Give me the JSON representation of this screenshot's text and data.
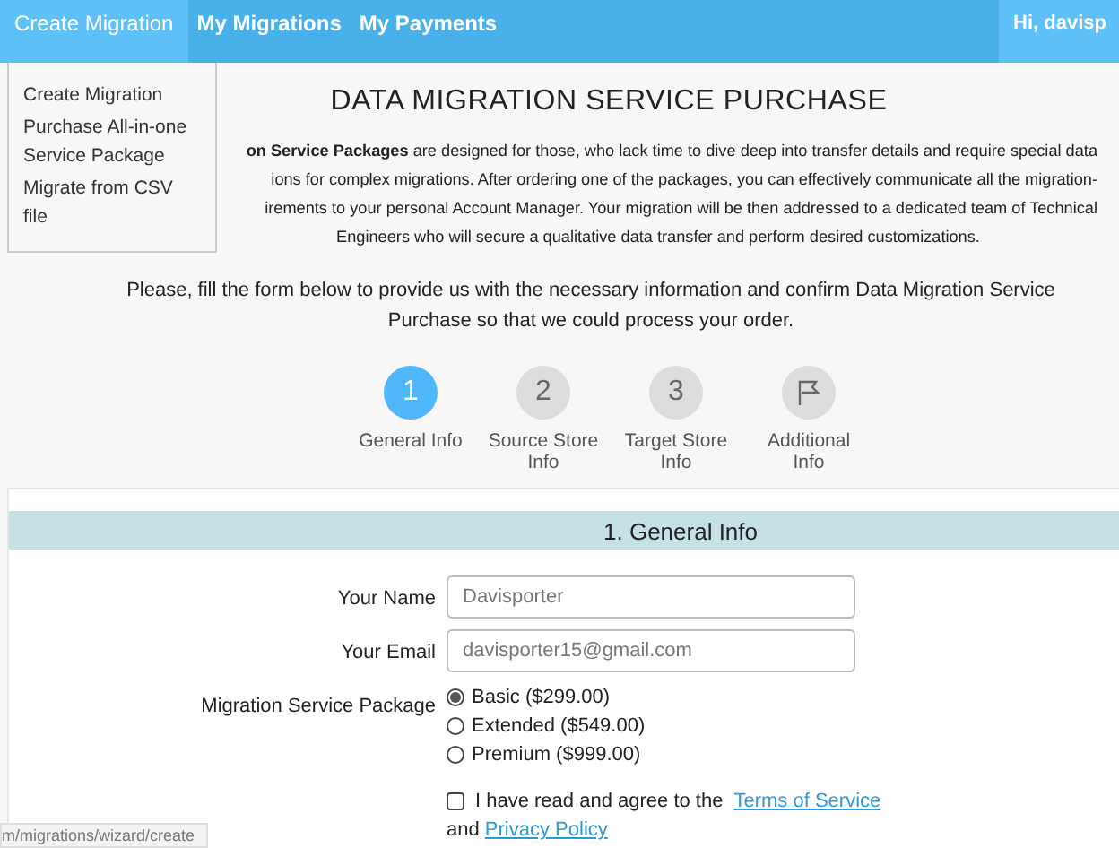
{
  "nav": {
    "tabs": [
      {
        "label": "Create Migration",
        "selected": true
      },
      {
        "label": "My Migrations",
        "selected": false
      },
      {
        "label": "My Payments",
        "selected": false
      }
    ],
    "greeting": "Hi, davisp"
  },
  "dropdown": {
    "items": [
      "Create Migration",
      "Purchase All-in-one Service Package",
      "Migrate from CSV file"
    ]
  },
  "title": "DATA MIGRATION SERVICE PURCHASE",
  "intro_lines": [
    "**on Service Packages** are designed for those, who lack time to dive deep into transfer details and require special data",
    "ions for complex migrations. After ordering one of the packages, you can effectively communicate all the migration-",
    "irements to your personal Account Manager. Your migration will be then addressed to a dedicated team of Technical",
    "Engineers who will secure a qualitative data transfer and perform desired customizations."
  ],
  "instruction": "Please, fill the form below to provide us with the necessary information and confirm Data Migration Service Purchase so that we could process your order.",
  "steps": [
    {
      "kind": "number",
      "number": "1",
      "label": "General Info",
      "selected": true
    },
    {
      "kind": "number",
      "number": "2",
      "label": "Source Store Info",
      "selected": false
    },
    {
      "kind": "number",
      "number": "3",
      "label": "Target Store Info",
      "selected": false
    },
    {
      "kind": "flag",
      "label": "Additional Info",
      "selected": false
    }
  ],
  "section": {
    "title": "1. General Info",
    "fields": [
      {
        "label": "Your Name",
        "value": "Davisporter"
      },
      {
        "label": "Your Email",
        "value": "davisporter15@gmail.com"
      }
    ],
    "package_label": "Migration Service Package",
    "packages": [
      {
        "label": "Basic ($299.00)",
        "selected": true
      },
      {
        "label": "Extended ($549.00)",
        "selected": false
      },
      {
        "label": "Premium ($999.00)",
        "selected": false
      }
    ],
    "agree": {
      "checked": false,
      "text": "I have read and agree to the",
      "terms_link": "Terms of Service",
      "and": "and",
      "privacy_link": "Privacy Policy"
    }
  },
  "status_url": "m/migrations/wizard/create"
}
